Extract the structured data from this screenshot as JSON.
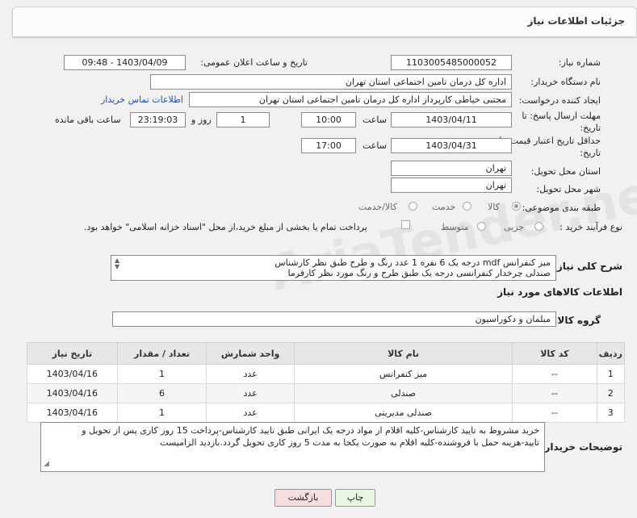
{
  "header": {
    "title": "جزئیات اطلاعات نیاز"
  },
  "form": {
    "need_number": {
      "label": "شماره نیاز:",
      "value": "1103005485000052"
    },
    "announce": {
      "label": "تاریخ و ساعت اعلان عمومی:",
      "value": "1403/04/09 - 09:48"
    },
    "buyer_org": {
      "label": "نام دستگاه خریدار:",
      "value": "اداره کل درمان تامین اجتماعی استان تهران"
    },
    "requester": {
      "label": "ایجاد کننده درخواست:",
      "value": "مجتبی خیاطی کارپرداز اداره کل درمان تامین اجتماعی استان تهران",
      "contact_link": "اطلاعات تماس خریدار"
    },
    "deadline": {
      "label1": "مهلت ارسال پاسخ: تا",
      "label2": "تاریخ:",
      "date": "1403/04/11",
      "time_label": "ساعت",
      "time": "10:00",
      "days": "1",
      "days_label": "روز و",
      "remaining": "23:19:03",
      "remaining_label": "ساعت باقی مانده"
    },
    "validity": {
      "label1": "حداقل تاریخ اعتبار قیمت: تا",
      "label2": "تاریخ:",
      "date": "1403/04/31",
      "time_label": "ساعت",
      "time": "17:00"
    },
    "province": {
      "label": "استان محل تحویل:",
      "value": "تهران"
    },
    "city": {
      "label": "شهر محل تحویل:",
      "value": "تهران"
    },
    "category": {
      "label": "طبقه بندی موضوعی:",
      "options": [
        "کالا",
        "خدمت",
        "کالا/خدمت"
      ],
      "selected": "کالا"
    },
    "purchase": {
      "label": "نوع فرآیند خرید :",
      "options": [
        "جزیی",
        "متوسط"
      ],
      "note": "پرداخت تمام یا بخشی از مبلغ خرید،از محل \"اسناد خزانه اسلامی\" خواهد بود."
    }
  },
  "description": {
    "label": "شرح کلی نیاز:",
    "line1": "میز کنفرانس mdf  درجه یک 6 نفره 1 عدد رنگ و طرح طبق نظر کارشناس",
    "line2": "صندلی چرخدار کنفرانسی درجه یک طبق طرح و رنگ مورد نظر کارفرما"
  },
  "goods": {
    "section_title": "اطلاعات کالاهای مورد نیاز",
    "group_label": "گروه کالا:",
    "group_value": "مبلمان و دکوراسیون",
    "columns": [
      "ردیف",
      "کد کالا",
      "نام کالا",
      "واحد شمارش",
      "تعداد / مقدار",
      "تاریخ نیاز"
    ],
    "rows": [
      [
        "1",
        "--",
        "میز کنفرانس",
        "عدد",
        "1",
        "1403/04/16"
      ],
      [
        "2",
        "--",
        "صندلی",
        "عدد",
        "6",
        "1403/04/16"
      ],
      [
        "3",
        "--",
        "صندلی مدیریتی",
        "عدد",
        "1",
        "1403/04/16"
      ]
    ]
  },
  "buyer_notes": {
    "label": "توضیحات خریدار:",
    "line1": "خرید مشروط به تایید کارشناس-کلیه اقلام از مواد درجه یک ایرانی طبق تایید کارشناس-پرداخت 15 روز کاری پس از تحویل و",
    "line2": "تایید-هزینه حمل با فروشنده-کلیه اقلام به صورت یکجا به مدت 5 روز کاری تحویل گردد.بازدید الزامیست"
  },
  "buttons": {
    "print": "چاپ",
    "back": "بازگشت"
  },
  "watermark": "AriaTender.net"
}
